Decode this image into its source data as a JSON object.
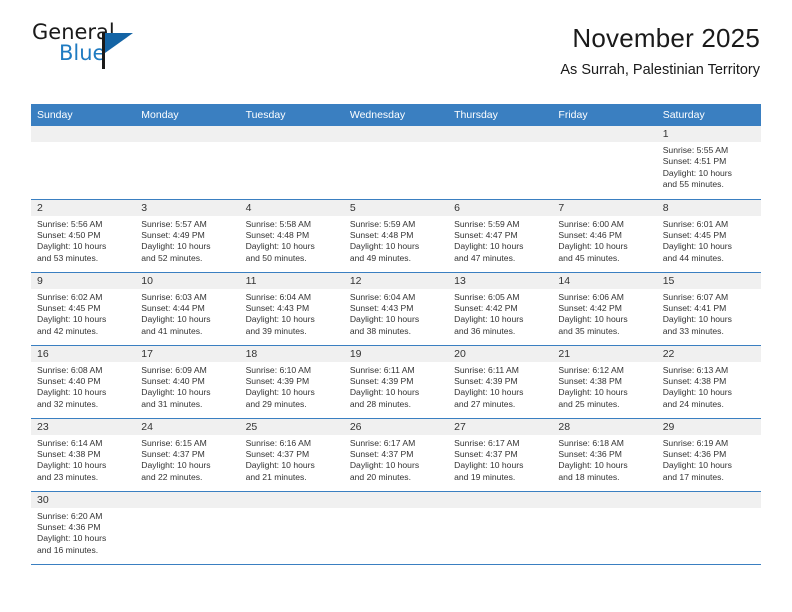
{
  "brand": {
    "name_top": "General",
    "name_bottom": "Blue",
    "accent_color": "#1464a5"
  },
  "header": {
    "title": "November 2025",
    "subtitle": "As Surrah, Palestinian Territory",
    "header_bg_color": "#3a7fc1"
  },
  "columns": [
    "Sunday",
    "Monday",
    "Tuesday",
    "Wednesday",
    "Thursday",
    "Friday",
    "Saturday"
  ],
  "labels": {
    "sunrise": "Sunrise:",
    "sunset": "Sunset:",
    "daylight": "Daylight:"
  },
  "weeks": [
    [
      {
        "day": "",
        "empty": true
      },
      {
        "day": "",
        "empty": true
      },
      {
        "day": "",
        "empty": true
      },
      {
        "day": "",
        "empty": true
      },
      {
        "day": "",
        "empty": true
      },
      {
        "day": "",
        "empty": true
      },
      {
        "day": "1",
        "sunrise": "Sunrise: 5:55 AM",
        "sunset": "Sunset: 4:51 PM",
        "daylight1": "Daylight: 10 hours",
        "daylight2": "and 55 minutes."
      }
    ],
    [
      {
        "day": "2",
        "sunrise": "Sunrise: 5:56 AM",
        "sunset": "Sunset: 4:50 PM",
        "daylight1": "Daylight: 10 hours",
        "daylight2": "and 53 minutes."
      },
      {
        "day": "3",
        "sunrise": "Sunrise: 5:57 AM",
        "sunset": "Sunset: 4:49 PM",
        "daylight1": "Daylight: 10 hours",
        "daylight2": "and 52 minutes."
      },
      {
        "day": "4",
        "sunrise": "Sunrise: 5:58 AM",
        "sunset": "Sunset: 4:48 PM",
        "daylight1": "Daylight: 10 hours",
        "daylight2": "and 50 minutes."
      },
      {
        "day": "5",
        "sunrise": "Sunrise: 5:59 AM",
        "sunset": "Sunset: 4:48 PM",
        "daylight1": "Daylight: 10 hours",
        "daylight2": "and 49 minutes."
      },
      {
        "day": "6",
        "sunrise": "Sunrise: 5:59 AM",
        "sunset": "Sunset: 4:47 PM",
        "daylight1": "Daylight: 10 hours",
        "daylight2": "and 47 minutes."
      },
      {
        "day": "7",
        "sunrise": "Sunrise: 6:00 AM",
        "sunset": "Sunset: 4:46 PM",
        "daylight1": "Daylight: 10 hours",
        "daylight2": "and 45 minutes."
      },
      {
        "day": "8",
        "sunrise": "Sunrise: 6:01 AM",
        "sunset": "Sunset: 4:45 PM",
        "daylight1": "Daylight: 10 hours",
        "daylight2": "and 44 minutes."
      }
    ],
    [
      {
        "day": "9",
        "sunrise": "Sunrise: 6:02 AM",
        "sunset": "Sunset: 4:45 PM",
        "daylight1": "Daylight: 10 hours",
        "daylight2": "and 42 minutes."
      },
      {
        "day": "10",
        "sunrise": "Sunrise: 6:03 AM",
        "sunset": "Sunset: 4:44 PM",
        "daylight1": "Daylight: 10 hours",
        "daylight2": "and 41 minutes."
      },
      {
        "day": "11",
        "sunrise": "Sunrise: 6:04 AM",
        "sunset": "Sunset: 4:43 PM",
        "daylight1": "Daylight: 10 hours",
        "daylight2": "and 39 minutes."
      },
      {
        "day": "12",
        "sunrise": "Sunrise: 6:04 AM",
        "sunset": "Sunset: 4:43 PM",
        "daylight1": "Daylight: 10 hours",
        "daylight2": "and 38 minutes."
      },
      {
        "day": "13",
        "sunrise": "Sunrise: 6:05 AM",
        "sunset": "Sunset: 4:42 PM",
        "daylight1": "Daylight: 10 hours",
        "daylight2": "and 36 minutes."
      },
      {
        "day": "14",
        "sunrise": "Sunrise: 6:06 AM",
        "sunset": "Sunset: 4:42 PM",
        "daylight1": "Daylight: 10 hours",
        "daylight2": "and 35 minutes."
      },
      {
        "day": "15",
        "sunrise": "Sunrise: 6:07 AM",
        "sunset": "Sunset: 4:41 PM",
        "daylight1": "Daylight: 10 hours",
        "daylight2": "and 33 minutes."
      }
    ],
    [
      {
        "day": "16",
        "sunrise": "Sunrise: 6:08 AM",
        "sunset": "Sunset: 4:40 PM",
        "daylight1": "Daylight: 10 hours",
        "daylight2": "and 32 minutes."
      },
      {
        "day": "17",
        "sunrise": "Sunrise: 6:09 AM",
        "sunset": "Sunset: 4:40 PM",
        "daylight1": "Daylight: 10 hours",
        "daylight2": "and 31 minutes."
      },
      {
        "day": "18",
        "sunrise": "Sunrise: 6:10 AM",
        "sunset": "Sunset: 4:39 PM",
        "daylight1": "Daylight: 10 hours",
        "daylight2": "and 29 minutes."
      },
      {
        "day": "19",
        "sunrise": "Sunrise: 6:11 AM",
        "sunset": "Sunset: 4:39 PM",
        "daylight1": "Daylight: 10 hours",
        "daylight2": "and 28 minutes."
      },
      {
        "day": "20",
        "sunrise": "Sunrise: 6:11 AM",
        "sunset": "Sunset: 4:39 PM",
        "daylight1": "Daylight: 10 hours",
        "daylight2": "and 27 minutes."
      },
      {
        "day": "21",
        "sunrise": "Sunrise: 6:12 AM",
        "sunset": "Sunset: 4:38 PM",
        "daylight1": "Daylight: 10 hours",
        "daylight2": "and 25 minutes."
      },
      {
        "day": "22",
        "sunrise": "Sunrise: 6:13 AM",
        "sunset": "Sunset: 4:38 PM",
        "daylight1": "Daylight: 10 hours",
        "daylight2": "and 24 minutes."
      }
    ],
    [
      {
        "day": "23",
        "sunrise": "Sunrise: 6:14 AM",
        "sunset": "Sunset: 4:38 PM",
        "daylight1": "Daylight: 10 hours",
        "daylight2": "and 23 minutes."
      },
      {
        "day": "24",
        "sunrise": "Sunrise: 6:15 AM",
        "sunset": "Sunset: 4:37 PM",
        "daylight1": "Daylight: 10 hours",
        "daylight2": "and 22 minutes."
      },
      {
        "day": "25",
        "sunrise": "Sunrise: 6:16 AM",
        "sunset": "Sunset: 4:37 PM",
        "daylight1": "Daylight: 10 hours",
        "daylight2": "and 21 minutes."
      },
      {
        "day": "26",
        "sunrise": "Sunrise: 6:17 AM",
        "sunset": "Sunset: 4:37 PM",
        "daylight1": "Daylight: 10 hours",
        "daylight2": "and 20 minutes."
      },
      {
        "day": "27",
        "sunrise": "Sunrise: 6:17 AM",
        "sunset": "Sunset: 4:37 PM",
        "daylight1": "Daylight: 10 hours",
        "daylight2": "and 19 minutes."
      },
      {
        "day": "28",
        "sunrise": "Sunrise: 6:18 AM",
        "sunset": "Sunset: 4:36 PM",
        "daylight1": "Daylight: 10 hours",
        "daylight2": "and 18 minutes."
      },
      {
        "day": "29",
        "sunrise": "Sunrise: 6:19 AM",
        "sunset": "Sunset: 4:36 PM",
        "daylight1": "Daylight: 10 hours",
        "daylight2": "and 17 minutes."
      }
    ],
    [
      {
        "day": "30",
        "sunrise": "Sunrise: 6:20 AM",
        "sunset": "Sunset: 4:36 PM",
        "daylight1": "Daylight: 10 hours",
        "daylight2": "and 16 minutes."
      },
      {
        "day": "",
        "blank": true
      },
      {
        "day": "",
        "blank": true
      },
      {
        "day": "",
        "blank": true
      },
      {
        "day": "",
        "blank": true
      },
      {
        "day": "",
        "blank": true
      },
      {
        "day": "",
        "blank": true
      }
    ]
  ]
}
